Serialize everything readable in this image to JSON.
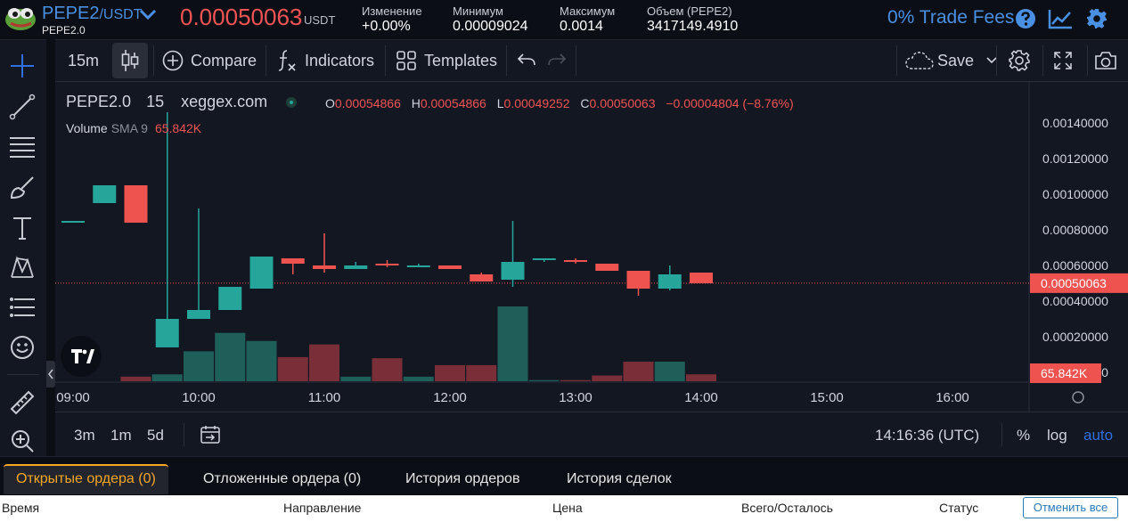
{
  "ticker": {
    "base": "PEPE2",
    "quote": "/USDT",
    "subtitle": "PEPE2.0",
    "last_price": "0.00050063",
    "price_unit": "USDT",
    "stats": [
      {
        "label": "Изменение",
        "value": "+0.00%"
      },
      {
        "label": "Минимум",
        "value": "0.00009024"
      },
      {
        "label": "Максимум",
        "value": "0.0014"
      },
      {
        "label": "Объем (PEPE2)",
        "value": "3417149.4910"
      }
    ],
    "fees_label": "0% Trade Fees",
    "icons": [
      "help-icon",
      "chart-line-icon",
      "settings-gear-icon"
    ],
    "colors": {
      "accent": "#4a90e2",
      "down": "#f05454",
      "up": "#26a69a"
    }
  },
  "toolbar": {
    "interval": "15m",
    "compare_label": "Compare",
    "indicators_label": "Indicators",
    "templates_label": "Templates",
    "save_label": "Save",
    "icons": [
      "candles-icon",
      "plus-circle-icon",
      "fx-icon",
      "grid-icon",
      "undo-icon",
      "redo-icon",
      "cloud-icon",
      "chevron-down-icon",
      "gear-icon",
      "fullscreen-icon",
      "camera-icon"
    ]
  },
  "left_toolbar": {
    "icons": [
      "crosshair-icon",
      "trend-line-icon",
      "horizontal-lines-icon",
      "brush-icon",
      "text-icon",
      "pattern-icon",
      "fib-icon",
      "emoji-icon",
      "ruler-icon",
      "zoom-in-icon"
    ]
  },
  "legend": {
    "symbol": "PEPE2.0",
    "interval": "15",
    "exchange": "xeggex.com",
    "o_key": "O",
    "o": "0.00054866",
    "h_key": "H",
    "h": "0.00054866",
    "l_key": "L",
    "l": "0.00049252",
    "c_key": "C",
    "c": "0.00050063",
    "change": "−0.00004804 (−8.76%)",
    "volume_name": "Volume",
    "volume_sma": "SMA 9",
    "volume_value": "65.842K"
  },
  "chart_data": {
    "type": "candlestick",
    "x_ticks": [
      "09:00",
      "10:00",
      "11:00",
      "12:00",
      "13:00",
      "14:00",
      "15:00",
      "16:00"
    ],
    "y_ticks": [
      "0.00140000",
      "0.00120000",
      "0.00100000",
      "0.00080000",
      "0.00060000",
      "0.00040000",
      "0.00020000",
      "0.00000000"
    ],
    "ylim": [
      0,
      0.00146
    ],
    "last_price_label": "0.00050063",
    "volume_label": "65.842K",
    "interval_minutes": 15,
    "colors": {
      "up": "#26a69a",
      "down": "#ef5350",
      "vol_up": "#1f5f5a",
      "vol_down": "#7a2f38"
    },
    "candles": [
      {
        "t": "09:00",
        "o": 0.00085,
        "h": 0.00085,
        "l": 0.00085,
        "c": 0.00085,
        "v": 0
      },
      {
        "t": "09:15",
        "o": 0.00095,
        "h": 0.00105,
        "l": 0.00095,
        "c": 0.00105,
        "v": 0
      },
      {
        "t": "09:30",
        "o": 0.00105,
        "h": 0.00105,
        "l": 0.00084,
        "c": 0.00084,
        "v": 4
      },
      {
        "t": "09:45",
        "o": 0.00014,
        "h": 0.00146,
        "l": 0.00014,
        "c": 0.0003,
        "v": 6
      },
      {
        "t": "10:00",
        "o": 0.0003,
        "h": 0.00092,
        "l": 0.0003,
        "c": 0.00035,
        "v": 26
      },
      {
        "t": "10:15",
        "o": 0.00035,
        "h": 0.00046,
        "l": 0.00035,
        "c": 0.00048,
        "v": 42
      },
      {
        "t": "10:30",
        "o": 0.00047,
        "h": 0.00065,
        "l": 0.00047,
        "c": 0.00065,
        "v": 35
      },
      {
        "t": "10:45",
        "o": 0.00064,
        "h": 0.00064,
        "l": 0.00055,
        "c": 0.00061,
        "v": 21
      },
      {
        "t": "11:00",
        "o": 0.0006,
        "h": 0.00078,
        "l": 0.00056,
        "c": 0.00058,
        "v": 32
      },
      {
        "t": "11:15",
        "o": 0.00058,
        "h": 0.00062,
        "l": 0.00058,
        "c": 0.0006,
        "v": 4
      },
      {
        "t": "11:30",
        "o": 0.00061,
        "h": 0.00063,
        "l": 0.00059,
        "c": 0.0006,
        "v": 20
      },
      {
        "t": "11:45",
        "o": 0.0006,
        "h": 0.00061,
        "l": 0.00059,
        "c": 0.0006,
        "v": 4
      },
      {
        "t": "12:00",
        "o": 0.0006,
        "h": 0.0006,
        "l": 0.00058,
        "c": 0.00058,
        "v": 14
      },
      {
        "t": "12:15",
        "o": 0.00055,
        "h": 0.00056,
        "l": 0.00051,
        "c": 0.00051,
        "v": 14
      },
      {
        "t": "12:30",
        "o": 0.00052,
        "h": 0.00085,
        "l": 0.00048,
        "c": 0.00062,
        "v": 65
      },
      {
        "t": "12:45",
        "o": 0.00063,
        "h": 0.00064,
        "l": 0.00062,
        "c": 0.00064,
        "v": 1
      },
      {
        "t": "13:00",
        "o": 0.00063,
        "h": 0.00064,
        "l": 0.00061,
        "c": 0.00062,
        "v": 1
      },
      {
        "t": "13:15",
        "o": 0.00061,
        "h": 0.00061,
        "l": 0.00057,
        "c": 0.00057,
        "v": 5
      },
      {
        "t": "13:30",
        "o": 0.00057,
        "h": 0.00057,
        "l": 0.00043,
        "c": 0.00047,
        "v": 17
      },
      {
        "t": "13:45",
        "o": 0.00047,
        "h": 0.0006,
        "l": 0.00046,
        "c": 0.00055,
        "v": 17
      },
      {
        "t": "14:00",
        "o": 0.00056,
        "h": 0.00056,
        "l": 0.0005,
        "c": 0.0005,
        "v": 6
      }
    ]
  },
  "timebar": {
    "ranges": [
      "3m",
      "1m",
      "5d"
    ],
    "clock": "14:16:36 (UTC)",
    "percent_label": "%",
    "log_label": "log",
    "auto_label": "auto"
  },
  "orders": {
    "tabs": [
      "Открытые ордера (0)",
      "Отложенные ордера (0)",
      "История ордеров",
      "История сделок"
    ],
    "columns": [
      "Время",
      "Направление",
      "Цена",
      "Всего/Осталось",
      "Статус"
    ],
    "cancel_all_label": "Отменить все"
  }
}
